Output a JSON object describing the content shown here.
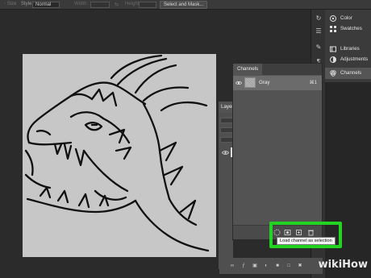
{
  "options_bar": {
    "style_label": "Style:",
    "style_value": "Normal",
    "width_label": "Width:",
    "height_label": "Height:",
    "select_mask_label": "Select and Mask..."
  },
  "panel_list": {
    "items": [
      {
        "label": "Color",
        "icon": "color-wheel-icon"
      },
      {
        "label": "Swatches",
        "icon": "grid-icon"
      },
      {
        "label": "Libraries",
        "icon": "library-icon"
      },
      {
        "label": "Adjustments",
        "icon": "adjustments-icon"
      },
      {
        "label": "Channels",
        "icon": "channels-icon",
        "selected": true
      }
    ]
  },
  "channels_panel": {
    "tab_label": "Channels",
    "channel_name": "Gray",
    "channel_shortcut": "⌘1"
  },
  "layers_panel": {
    "tab_label": "Layers"
  },
  "highlight": {
    "tooltip": "Load channel as selection",
    "color": "#22d322"
  },
  "watermark": {
    "part_a": "wiki",
    "part_b": "How"
  }
}
